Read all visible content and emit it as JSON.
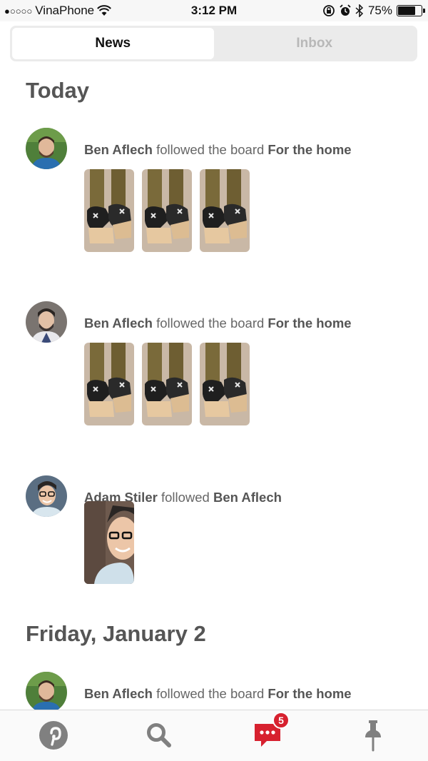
{
  "status_bar": {
    "signal_dots": "●○○○○",
    "carrier": "VinaPhone",
    "time": "3:12 PM",
    "battery_percent": "75%",
    "battery_level": 0.75
  },
  "tabs": {
    "news_label": "News",
    "inbox_label": "Inbox",
    "active": "News"
  },
  "feed": {
    "sections": [
      {
        "title": "Today",
        "items": [
          {
            "actor": "Ben Aflech",
            "action": " followed the board ",
            "target": "For the home",
            "thumbnail_count": 3
          },
          {
            "actor": "Ben Aflech",
            "action": " followed the board ",
            "target": "For the home",
            "thumbnail_count": 3
          },
          {
            "actor": "Adam Stiler",
            "action": " followed ",
            "target": "Ben Aflech",
            "thumbnail_count": 1
          }
        ]
      },
      {
        "title": "Friday, January 2",
        "items": [
          {
            "actor": "Ben Aflech",
            "action": " followed the board ",
            "target": "For the home"
          }
        ]
      }
    ]
  },
  "tabbar": {
    "icons": [
      "pinterest-logo-icon",
      "search-icon",
      "chat-bubble-icon",
      "pin-icon"
    ],
    "notification_badge": "5",
    "accent_color": "#d7212f",
    "icon_color": "#808080"
  }
}
